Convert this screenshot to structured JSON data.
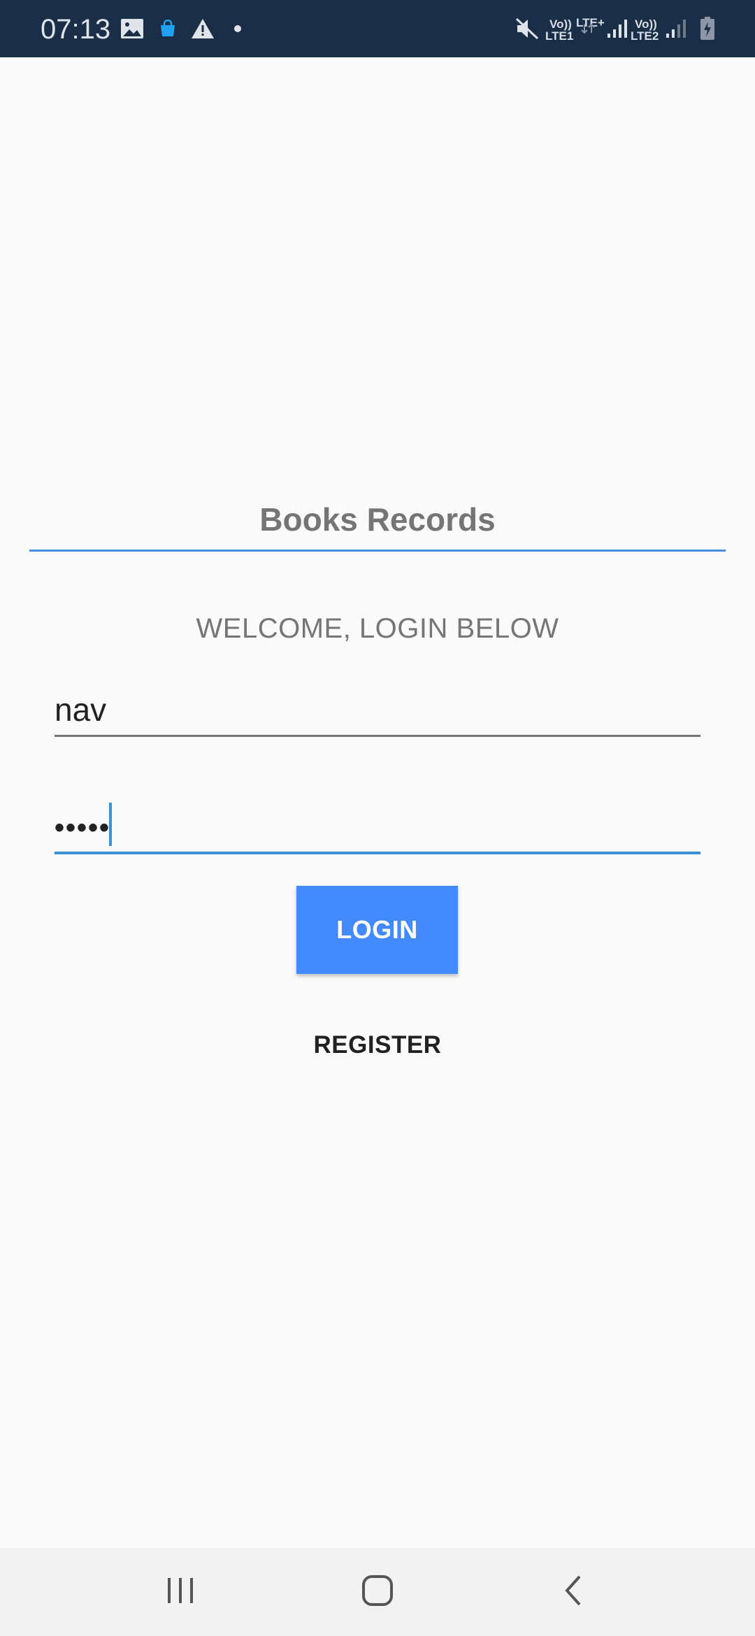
{
  "status_bar": {
    "time": "07:13",
    "sim1_label_top": "Vo))",
    "sim1_label_bottom": "LTE1",
    "net_label": "LTE+",
    "sim2_label_top": "Vo))",
    "sim2_label_bottom": "LTE2",
    "icons": [
      "gallery-icon",
      "shopping-bag-icon",
      "warning-icon",
      "dot-icon",
      "mute-icon",
      "signal-icon",
      "battery-charging-icon"
    ],
    "colors": {
      "background": "#1b2e48",
      "accent": "#1ea1f2"
    }
  },
  "app": {
    "title": "Books Records",
    "welcome": "WELCOME, LOGIN BELOW"
  },
  "form": {
    "username_value": "nav",
    "password_value": "•••••",
    "login_label": "LOGIN",
    "register_label": "REGISTER"
  },
  "colors": {
    "primary": "#448aff",
    "focus_underline": "#3d8fd6",
    "title_text": "#757575"
  },
  "nav_bar": {
    "icons": [
      "recent-apps-icon",
      "home-icon",
      "back-icon"
    ]
  }
}
